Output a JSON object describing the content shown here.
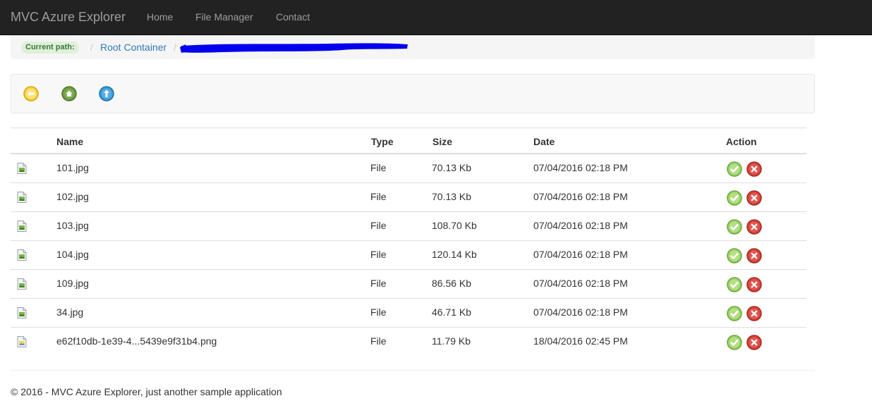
{
  "navbar": {
    "brand": "MVC Azure Explorer",
    "links": [
      {
        "label": "Home"
      },
      {
        "label": "File Manager"
      },
      {
        "label": "Contact"
      }
    ]
  },
  "breadcrumb": {
    "label": "Current path:",
    "items": [
      {
        "label": "Root Container"
      }
    ]
  },
  "toolbar": {
    "buttons": [
      {
        "icon": "back-arrow-icon",
        "color": "#f0c020"
      },
      {
        "icon": "home-icon",
        "color": "#5a8a3a"
      },
      {
        "icon": "upload-icon",
        "color": "#2a8fc8"
      }
    ]
  },
  "table": {
    "headers": {
      "name": "Name",
      "type": "Type",
      "size": "Size",
      "date": "Date",
      "action": "Action"
    },
    "rows": [
      {
        "icon": "image-file-icon",
        "name": "101.jpg",
        "type": "File",
        "size": "70.13 Kb",
        "date": "07/04/2016 02:18 PM"
      },
      {
        "icon": "image-file-icon",
        "name": "102.jpg",
        "type": "File",
        "size": "70.13 Kb",
        "date": "07/04/2016 02:18 PM"
      },
      {
        "icon": "image-file-icon",
        "name": "103.jpg",
        "type": "File",
        "size": "108.70 Kb",
        "date": "07/04/2016 02:18 PM"
      },
      {
        "icon": "image-file-icon",
        "name": "104.jpg",
        "type": "File",
        "size": "120.14 Kb",
        "date": "07/04/2016 02:18 PM"
      },
      {
        "icon": "image-file-icon",
        "name": "109.jpg",
        "type": "File",
        "size": "86.56 Kb",
        "date": "07/04/2016 02:18 PM"
      },
      {
        "icon": "image-file-icon",
        "name": "34.jpg",
        "type": "File",
        "size": "46.71 Kb",
        "date": "07/04/2016 02:18 PM"
      },
      {
        "icon": "png-file-icon",
        "name": "e62f10db-1e39-4...5439e9f31b4.png",
        "type": "File",
        "size": "11.79 Kb",
        "date": "18/04/2016 02:45 PM"
      }
    ]
  },
  "footer": {
    "text": "© 2016 - MVC Azure Explorer, just another sample application"
  },
  "colors": {
    "navbar_bg": "#222222",
    "link_blue": "#337ab7",
    "approve_green": "#8cc152",
    "delete_red": "#c0392b"
  }
}
